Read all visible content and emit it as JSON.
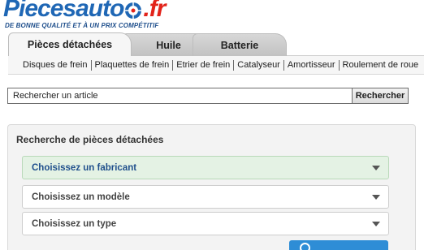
{
  "logo": {
    "name_part1": "Piecesauto",
    "name_part2": ".fr",
    "tagline": "DE BONNE QUALITÉ ET À UN PRIX COMPÉTITIF",
    "wheel_icon": "wheel-icon"
  },
  "tabs": [
    {
      "label": "Pièces détachées",
      "active": true
    },
    {
      "label": "Huile",
      "active": false
    },
    {
      "label": "Batterie",
      "active": false
    }
  ],
  "subnav": [
    "Disques de frein",
    "Plaquettes de frein",
    "Etrier de frein",
    "Catalyseur",
    "Amortisseur",
    "Roulement de roue"
  ],
  "search": {
    "value": "Rechercher un article",
    "button_label": "Rechercher"
  },
  "panel": {
    "title": "Recherche de pièces détachées",
    "selects": [
      {
        "value": "Choisissez un fabricant"
      },
      {
        "value": "Choisissez un modèle"
      },
      {
        "value": "Choisissez un type"
      }
    ]
  },
  "colors": {
    "brand_blue": "#1f67b5",
    "brand_red": "#e2231a",
    "active_select_bg": "#e4f2e4",
    "button_blue": "#2e8dd6"
  }
}
